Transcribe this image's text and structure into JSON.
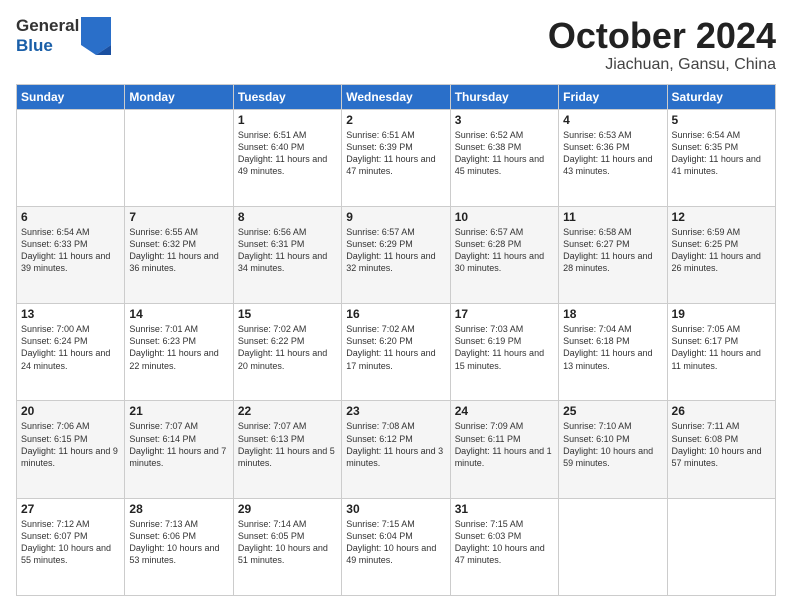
{
  "header": {
    "logo_line1": "General",
    "logo_line2": "Blue",
    "month": "October 2024",
    "location": "Jiachuan, Gansu, China"
  },
  "weekdays": [
    "Sunday",
    "Monday",
    "Tuesday",
    "Wednesday",
    "Thursday",
    "Friday",
    "Saturday"
  ],
  "weeks": [
    [
      {
        "day": "",
        "info": ""
      },
      {
        "day": "",
        "info": ""
      },
      {
        "day": "1",
        "info": "Sunrise: 6:51 AM\nSunset: 6:40 PM\nDaylight: 11 hours and 49 minutes."
      },
      {
        "day": "2",
        "info": "Sunrise: 6:51 AM\nSunset: 6:39 PM\nDaylight: 11 hours and 47 minutes."
      },
      {
        "day": "3",
        "info": "Sunrise: 6:52 AM\nSunset: 6:38 PM\nDaylight: 11 hours and 45 minutes."
      },
      {
        "day": "4",
        "info": "Sunrise: 6:53 AM\nSunset: 6:36 PM\nDaylight: 11 hours and 43 minutes."
      },
      {
        "day": "5",
        "info": "Sunrise: 6:54 AM\nSunset: 6:35 PM\nDaylight: 11 hours and 41 minutes."
      }
    ],
    [
      {
        "day": "6",
        "info": "Sunrise: 6:54 AM\nSunset: 6:33 PM\nDaylight: 11 hours and 39 minutes."
      },
      {
        "day": "7",
        "info": "Sunrise: 6:55 AM\nSunset: 6:32 PM\nDaylight: 11 hours and 36 minutes."
      },
      {
        "day": "8",
        "info": "Sunrise: 6:56 AM\nSunset: 6:31 PM\nDaylight: 11 hours and 34 minutes."
      },
      {
        "day": "9",
        "info": "Sunrise: 6:57 AM\nSunset: 6:29 PM\nDaylight: 11 hours and 32 minutes."
      },
      {
        "day": "10",
        "info": "Sunrise: 6:57 AM\nSunset: 6:28 PM\nDaylight: 11 hours and 30 minutes."
      },
      {
        "day": "11",
        "info": "Sunrise: 6:58 AM\nSunset: 6:27 PM\nDaylight: 11 hours and 28 minutes."
      },
      {
        "day": "12",
        "info": "Sunrise: 6:59 AM\nSunset: 6:25 PM\nDaylight: 11 hours and 26 minutes."
      }
    ],
    [
      {
        "day": "13",
        "info": "Sunrise: 7:00 AM\nSunset: 6:24 PM\nDaylight: 11 hours and 24 minutes."
      },
      {
        "day": "14",
        "info": "Sunrise: 7:01 AM\nSunset: 6:23 PM\nDaylight: 11 hours and 22 minutes."
      },
      {
        "day": "15",
        "info": "Sunrise: 7:02 AM\nSunset: 6:22 PM\nDaylight: 11 hours and 20 minutes."
      },
      {
        "day": "16",
        "info": "Sunrise: 7:02 AM\nSunset: 6:20 PM\nDaylight: 11 hours and 17 minutes."
      },
      {
        "day": "17",
        "info": "Sunrise: 7:03 AM\nSunset: 6:19 PM\nDaylight: 11 hours and 15 minutes."
      },
      {
        "day": "18",
        "info": "Sunrise: 7:04 AM\nSunset: 6:18 PM\nDaylight: 11 hours and 13 minutes."
      },
      {
        "day": "19",
        "info": "Sunrise: 7:05 AM\nSunset: 6:17 PM\nDaylight: 11 hours and 11 minutes."
      }
    ],
    [
      {
        "day": "20",
        "info": "Sunrise: 7:06 AM\nSunset: 6:15 PM\nDaylight: 11 hours and 9 minutes."
      },
      {
        "day": "21",
        "info": "Sunrise: 7:07 AM\nSunset: 6:14 PM\nDaylight: 11 hours and 7 minutes."
      },
      {
        "day": "22",
        "info": "Sunrise: 7:07 AM\nSunset: 6:13 PM\nDaylight: 11 hours and 5 minutes."
      },
      {
        "day": "23",
        "info": "Sunrise: 7:08 AM\nSunset: 6:12 PM\nDaylight: 11 hours and 3 minutes."
      },
      {
        "day": "24",
        "info": "Sunrise: 7:09 AM\nSunset: 6:11 PM\nDaylight: 11 hours and 1 minute."
      },
      {
        "day": "25",
        "info": "Sunrise: 7:10 AM\nSunset: 6:10 PM\nDaylight: 10 hours and 59 minutes."
      },
      {
        "day": "26",
        "info": "Sunrise: 7:11 AM\nSunset: 6:08 PM\nDaylight: 10 hours and 57 minutes."
      }
    ],
    [
      {
        "day": "27",
        "info": "Sunrise: 7:12 AM\nSunset: 6:07 PM\nDaylight: 10 hours and 55 minutes."
      },
      {
        "day": "28",
        "info": "Sunrise: 7:13 AM\nSunset: 6:06 PM\nDaylight: 10 hours and 53 minutes."
      },
      {
        "day": "29",
        "info": "Sunrise: 7:14 AM\nSunset: 6:05 PM\nDaylight: 10 hours and 51 minutes."
      },
      {
        "day": "30",
        "info": "Sunrise: 7:15 AM\nSunset: 6:04 PM\nDaylight: 10 hours and 49 minutes."
      },
      {
        "day": "31",
        "info": "Sunrise: 7:15 AM\nSunset: 6:03 PM\nDaylight: 10 hours and 47 minutes."
      },
      {
        "day": "",
        "info": ""
      },
      {
        "day": "",
        "info": ""
      }
    ]
  ]
}
